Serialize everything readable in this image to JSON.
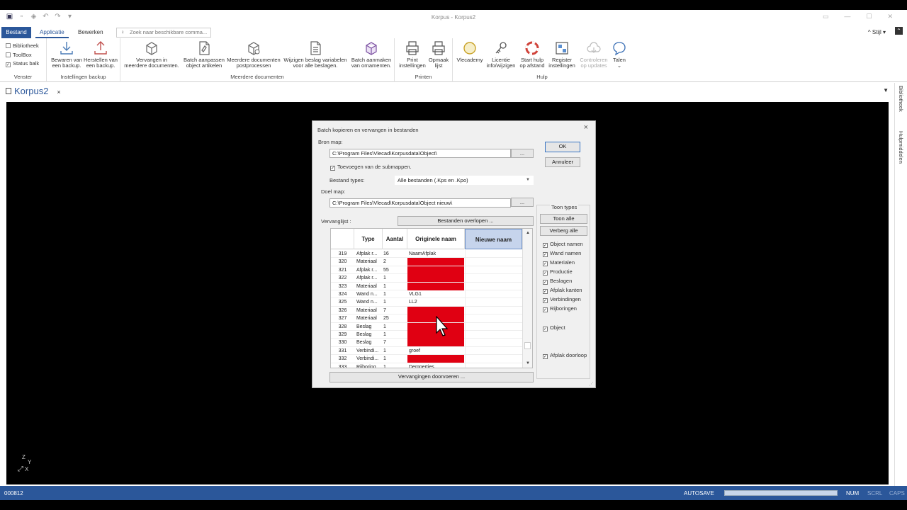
{
  "window": {
    "title": "Korpus - Korpus2"
  },
  "tabs": {
    "file": "Bestand",
    "applicatie": "Applicatie",
    "bewerken": "Bewerken",
    "search_placeholder": "Zoek naar beschikbare comma...",
    "stijl": "Stijl"
  },
  "ribbon": {
    "venster": {
      "label": "Venster",
      "items": [
        {
          "label": "Bibliotheek",
          "checked": false
        },
        {
          "label": "ToolBox",
          "checked": false
        },
        {
          "label": "Status balk",
          "checked": true
        }
      ]
    },
    "backup": {
      "label": "Instellingen backup",
      "buttons": [
        {
          "line1": "Bewaren van",
          "line2": "een backup."
        },
        {
          "line1": "Herstellen van",
          "line2": "een backup."
        }
      ]
    },
    "meerdere": {
      "label": "Meerdere documenten",
      "buttons": [
        {
          "line1": "Vervangen in",
          "line2": "meerdere documenten."
        },
        {
          "line1": "Batch aanpassen",
          "line2": "object artikelen"
        },
        {
          "line1": "Meerdere documenten",
          "line2": "postprocessen"
        },
        {
          "line1": "Wijzigen beslag variabelen",
          "line2": "voor alle beslagen."
        },
        {
          "line1": "Batch aanmaken",
          "line2": "van ornamenten."
        }
      ]
    },
    "printen": {
      "label": "Printen",
      "buttons": [
        {
          "line1": "Print",
          "line2": "instellingen"
        },
        {
          "line1": "Opmaak",
          "line2": "lijst"
        }
      ]
    },
    "hulp": {
      "label": "Hulp",
      "buttons": [
        {
          "line1": "Vlecademy",
          "line2": ""
        },
        {
          "line1": "Licentie",
          "line2": "info/wijzigen"
        },
        {
          "line1": "Start hulp",
          "line2": "op afstand"
        },
        {
          "line1": "Register",
          "line2": "instellingen"
        },
        {
          "line1": "Controleren",
          "line2": "op updates"
        },
        {
          "line1": "Talen",
          "line2": "⌄"
        }
      ]
    }
  },
  "document": {
    "tab_label": "Korpus2",
    "close": "×"
  },
  "sidepanel": {
    "bibliotheek": "Bibliotheek",
    "hulpmiddelen": "Hulpmiddelen"
  },
  "axis": {
    "z": "Z",
    "y": "Y",
    "x": "X"
  },
  "statusbar": {
    "code": "000812",
    "autosave": "AUTOSAVE",
    "num": "NUM",
    "scrl": "SCRL",
    "caps": "CAPS",
    "progress": 1.0
  },
  "dialog": {
    "title": "Batch kopieren en vervangen in bestanden",
    "ok": "OK",
    "cancel": "Annuleer",
    "bron_label": "Bron map:",
    "bron_value": "C:\\Program Files\\Vlecad\\Korpusdata\\Object\\",
    "browse": "...",
    "submappen": "Toevoegen van de submappen.",
    "types_label": "Bestand types:",
    "types_value": "Alle bestanden (.Kps en .Kpo)",
    "doel_label": "Doel map:",
    "doel_value": "C:\\Program Files\\Vlecad\\Korpusdata\\Object nieuw\\",
    "vervanglijst_label": "Vervanglijst :",
    "overlopen": "Bestanden overlopen ...",
    "doorvoeren": "Vervangingen doorvoeren ...",
    "columns": {
      "type": "Type",
      "aantal": "Aantal",
      "orig": "Originele naam",
      "new": "Nieuwe naam"
    },
    "rows": [
      {
        "num": "319",
        "type": "Afplak r...",
        "count": "16",
        "orig": "NaamAfplak",
        "red": false
      },
      {
        "num": "320",
        "type": "Materiaal",
        "count": "2",
        "orig": "",
        "red": true
      },
      {
        "num": "321",
        "type": "Afplak r...",
        "count": "55",
        "orig": "",
        "red": true
      },
      {
        "num": "322",
        "type": "Afplak r...",
        "count": "1",
        "orig": "",
        "red": true
      },
      {
        "num": "323",
        "type": "Materiaal",
        "count": "1",
        "orig": "",
        "red": true
      },
      {
        "num": "324",
        "type": "Wand n...",
        "count": "1",
        "orig": "VLG1",
        "red": false
      },
      {
        "num": "325",
        "type": "Wand n...",
        "count": "1",
        "orig": "LL2",
        "red": false
      },
      {
        "num": "326",
        "type": "Materiaal",
        "count": "7",
        "orig": "",
        "red": true
      },
      {
        "num": "327",
        "type": "Materiaal",
        "count": "25",
        "orig": "",
        "red": true
      },
      {
        "num": "328",
        "type": "Beslag",
        "count": "1",
        "orig": "",
        "red": true
      },
      {
        "num": "329",
        "type": "Beslag",
        "count": "1",
        "orig": "",
        "red": true
      },
      {
        "num": "330",
        "type": "Beslag",
        "count": "7",
        "orig": "",
        "red": true
      },
      {
        "num": "331",
        "type": "Verbindi...",
        "count": "1",
        "orig": "groef",
        "red": false
      },
      {
        "num": "332",
        "type": "Verbindi...",
        "count": "1",
        "orig": "",
        "red": true
      },
      {
        "num": "333",
        "type": "Rijboring",
        "count": "1",
        "orig": "Dempertjes",
        "red": false
      }
    ],
    "toon_types": {
      "title": "Toon types",
      "show_all": "Toon alle",
      "hide_all": "Verberg alle",
      "items": [
        "Object namen",
        "Wand namen",
        "Materialen",
        "Productie",
        "Beslagen",
        "Afplak kanten",
        "Verbindingen",
        "Rijboringen"
      ],
      "object": "Object",
      "afplak_doorloop": "Afplak doorloop"
    }
  },
  "colors": {
    "accent": "#2b579a",
    "red_cell": "#e00012"
  }
}
